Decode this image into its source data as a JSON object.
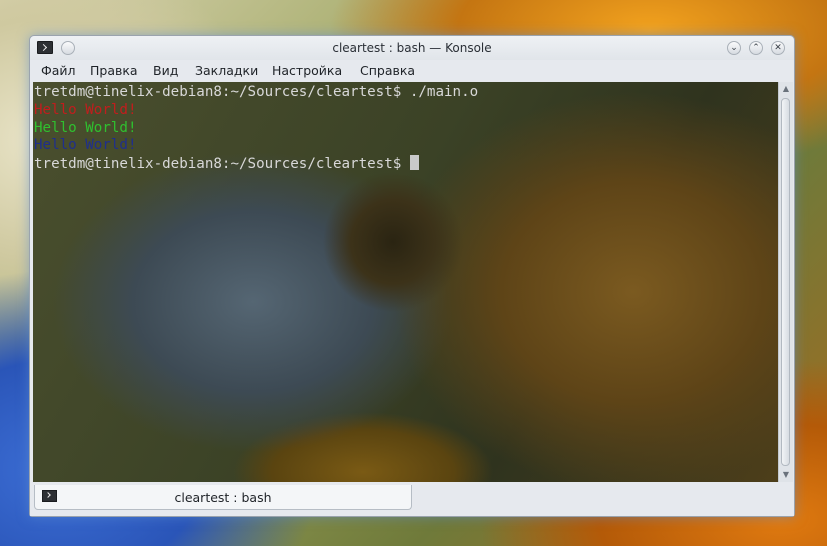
{
  "window": {
    "title": "cleartest : bash — Konsole",
    "buttons": {
      "minimize": "⌄",
      "maximize": "⌃",
      "close": "✕"
    }
  },
  "menubar": {
    "items": [
      "Файл",
      "Правка",
      "Вид",
      "Закладки",
      "Настройка",
      "Справка"
    ]
  },
  "terminal": {
    "lines": [
      {
        "text": "tretdm@tinelix-debian8:~/Sources/cleartest$ ./main.o",
        "color": "#d8d8d8"
      },
      {
        "text": "Hello World!",
        "color": "#c21d1d"
      },
      {
        "text": "Hello World!",
        "color": "#2fc02f"
      },
      {
        "text": "Hello World!",
        "color": "#1f2f8c"
      },
      {
        "text": "tretdm@tinelix-debian8:~/Sources/cleartest$ ",
        "color": "#d8d8d8",
        "cursor": true
      }
    ]
  },
  "tabs": [
    {
      "label": "cleartest : bash",
      "icon": "terminal-icon"
    }
  ],
  "colors": {
    "accent_glow": "#5a8cd2",
    "terminal_text": "#d8d8d8"
  }
}
